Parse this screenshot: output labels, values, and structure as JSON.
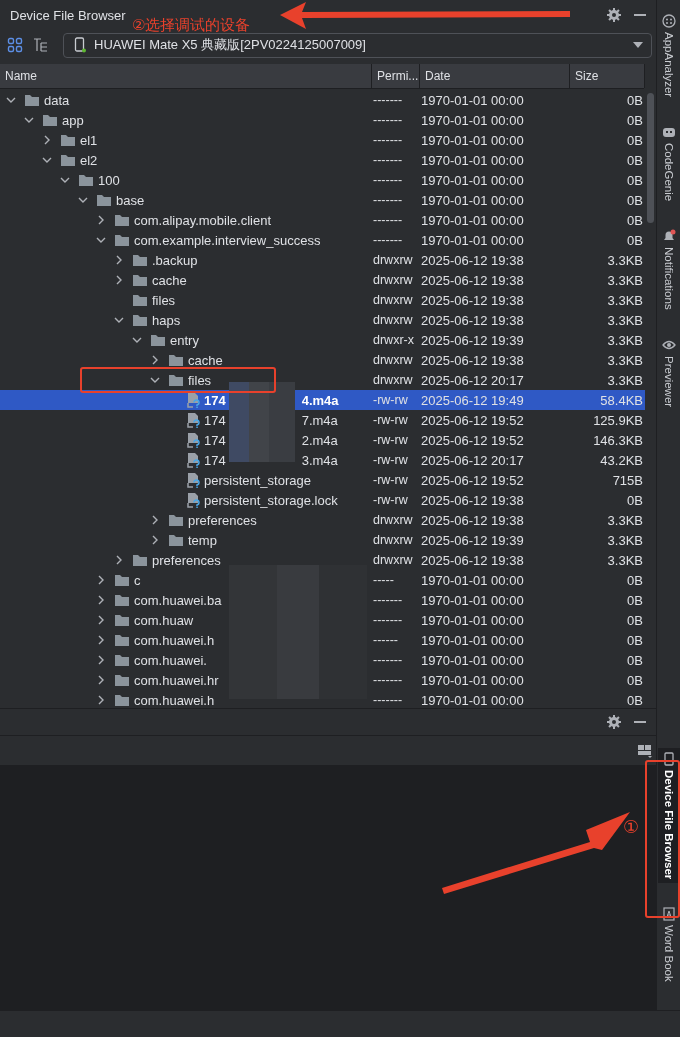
{
  "panel": {
    "title": "Device File Browser"
  },
  "device_selector": {
    "value": "HUAWEI Mate X5 典藏版[2PV0224125007009]"
  },
  "table": {
    "columns": [
      "Name",
      "Permi...",
      "Date",
      "Size"
    ],
    "tree": [
      {
        "name": "data",
        "kind": "folder",
        "expanded": true,
        "selected": false,
        "perm": "-------",
        "date": "1970-01-01 00:00",
        "size": "0B",
        "children": [
          {
            "name": "app",
            "kind": "folder",
            "expanded": true,
            "selected": false,
            "perm": "-------",
            "date": "1970-01-01 00:00",
            "size": "0B",
            "children": [
              {
                "name": "el1",
                "kind": "folder",
                "expanded": false,
                "selected": false,
                "perm": "-------",
                "date": "1970-01-01 00:00",
                "size": "0B"
              },
              {
                "name": "el2",
                "kind": "folder",
                "expanded": true,
                "selected": false,
                "perm": "-------",
                "date": "1970-01-01 00:00",
                "size": "0B",
                "children": [
                  {
                    "name": "100",
                    "kind": "folder",
                    "expanded": true,
                    "selected": false,
                    "perm": "-------",
                    "date": "1970-01-01 00:00",
                    "size": "0B",
                    "children": [
                      {
                        "name": "base",
                        "kind": "folder",
                        "expanded": true,
                        "selected": false,
                        "perm": "-------",
                        "date": "1970-01-01 00:00",
                        "size": "0B",
                        "children": [
                          {
                            "name": "com.alipay.mobile.client",
                            "kind": "folder",
                            "expanded": false,
                            "selected": false,
                            "perm": "-------",
                            "date": "1970-01-01 00:00",
                            "size": "0B"
                          },
                          {
                            "name": "com.example.interview_success",
                            "kind": "folder",
                            "expanded": true,
                            "selected": false,
                            "perm": "-------",
                            "date": "1970-01-01 00:00",
                            "size": "0B",
                            "children": [
                              {
                                "name": ".backup",
                                "kind": "folder",
                                "expanded": false,
                                "selected": false,
                                "perm": "drwxrw",
                                "date": "2025-06-12 19:38",
                                "size": "3.3KB"
                              },
                              {
                                "name": "cache",
                                "kind": "folder",
                                "expanded": false,
                                "selected": false,
                                "perm": "drwxrw",
                                "date": "2025-06-12 19:38",
                                "size": "3.3KB"
                              },
                              {
                                "name": "files",
                                "kind": "folder",
                                "selected": false,
                                "perm": "drwxrw",
                                "date": "2025-06-12 19:38",
                                "size": "3.3KB"
                              },
                              {
                                "name": "haps",
                                "kind": "folder",
                                "expanded": true,
                                "selected": false,
                                "perm": "drwxrw",
                                "date": "2025-06-12 19:38",
                                "size": "3.3KB",
                                "children": [
                                  {
                                    "name": "entry",
                                    "kind": "folder",
                                    "expanded": true,
                                    "selected": false,
                                    "perm": "drwxr-x",
                                    "date": "2025-06-12 19:39",
                                    "size": "3.3KB",
                                    "children": [
                                      {
                                        "name": "cache",
                                        "kind": "folder",
                                        "expanded": false,
                                        "selected": false,
                                        "perm": "drwxrw",
                                        "date": "2025-06-12 19:38",
                                        "size": "3.3KB"
                                      },
                                      {
                                        "name": "files",
                                        "kind": "folder",
                                        "expanded": true,
                                        "selected": false,
                                        "perm": "drwxrw",
                                        "date": "2025-06-12 20:17",
                                        "size": "3.3KB",
                                        "children": [
                                          {
                                            "name": "174",
                                            "name_tail": "4.m4a",
                                            "kind": "file",
                                            "selected": true,
                                            "perm": "-rw-rw",
                                            "date": "2025-06-12 19:49",
                                            "size": "58.4KB"
                                          },
                                          {
                                            "name": "174",
                                            "name_tail": "7.m4a",
                                            "kind": "file",
                                            "selected": false,
                                            "perm": "-rw-rw",
                                            "date": "2025-06-12 19:52",
                                            "size": "125.9KB"
                                          },
                                          {
                                            "name": "174",
                                            "name_tail": "2.m4a",
                                            "kind": "file",
                                            "selected": false,
                                            "perm": "-rw-rw",
                                            "date": "2025-06-12 19:52",
                                            "size": "146.3KB"
                                          },
                                          {
                                            "name": "174",
                                            "name_tail": "3.m4a",
                                            "kind": "file",
                                            "selected": false,
                                            "perm": "-rw-rw",
                                            "date": "2025-06-12 20:17",
                                            "size": "43.2KB"
                                          },
                                          {
                                            "name": "persistent_storage",
                                            "kind": "file",
                                            "selected": false,
                                            "perm": "-rw-rw",
                                            "date": "2025-06-12 19:52",
                                            "size": "715B"
                                          },
                                          {
                                            "name": "persistent_storage.lock",
                                            "kind": "file",
                                            "selected": false,
                                            "perm": "-rw-rw",
                                            "date": "2025-06-12 19:38",
                                            "size": "0B"
                                          }
                                        ]
                                      },
                                      {
                                        "name": "preferences",
                                        "kind": "folder",
                                        "expanded": false,
                                        "selected": false,
                                        "perm": "drwxrw",
                                        "date": "2025-06-12 19:38",
                                        "size": "3.3KB"
                                      },
                                      {
                                        "name": "temp",
                                        "kind": "folder",
                                        "expanded": false,
                                        "selected": false,
                                        "perm": "drwxrw",
                                        "date": "2025-06-12 19:39",
                                        "size": "3.3KB"
                                      }
                                    ]
                                  }
                                ]
                              },
                              {
                                "name": "preferences",
                                "kind": "folder",
                                "expanded": false,
                                "selected": false,
                                "perm": "drwxrw",
                                "date": "2025-06-12 19:38",
                                "size": "3.3KB"
                              }
                            ]
                          },
                          {
                            "name": "c",
                            "kind": "folder",
                            "expanded": false,
                            "selected": false,
                            "perm": "-----",
                            "date": "1970-01-01 00:00",
                            "size": "0B"
                          },
                          {
                            "name": "com.huawei.ba",
                            "kind": "folder",
                            "expanded": false,
                            "selected": false,
                            "perm": "-------",
                            "date": "1970-01-01 00:00",
                            "size": "0B"
                          },
                          {
                            "name": "com.huaw",
                            "kind": "folder",
                            "expanded": false,
                            "selected": false,
                            "perm": "-------",
                            "date": "1970-01-01 00:00",
                            "size": "0B"
                          },
                          {
                            "name": "com.huawei.h",
                            "kind": "folder",
                            "expanded": false,
                            "selected": false,
                            "perm": "------",
                            "date": "1970-01-01 00:00",
                            "size": "0B"
                          },
                          {
                            "name": "com.huawei.",
                            "kind": "folder",
                            "expanded": false,
                            "selected": false,
                            "perm": "-------",
                            "date": "1970-01-01 00:00",
                            "size": "0B"
                          },
                          {
                            "name": "com.huawei.hr",
                            "kind": "folder",
                            "expanded": false,
                            "selected": false,
                            "perm": "-------",
                            "date": "1970-01-01 00:00",
                            "size": "0B"
                          },
                          {
                            "name": "com.huawei.h",
                            "kind": "folder",
                            "expanded": false,
                            "selected": false,
                            "perm": "-------",
                            "date": "1970-01-01 00:00",
                            "size": "0B"
                          }
                        ]
                      }
                    ]
                  }
                ]
              }
            ]
          }
        ]
      }
    ]
  },
  "right_sidebar": {
    "top_tabs": [
      {
        "label": "AppAnalyzer",
        "kind": "analyzer",
        "selected": false
      },
      {
        "label": "CodeGenie",
        "kind": "genie",
        "selected": false
      },
      {
        "label": "Notifications",
        "kind": "bell",
        "selected": false
      },
      {
        "label": "Previewer",
        "kind": "eye",
        "selected": false
      }
    ],
    "bottom_tabs": [
      {
        "label": "Device File Browser",
        "kind": "device",
        "selected": true
      },
      {
        "label": "Word Book",
        "kind": "book",
        "selected": false
      }
    ]
  },
  "annotations": [
    {
      "kind": "label",
      "text": "②选择调试的设备"
    },
    {
      "kind": "label",
      "text": "①"
    }
  ]
}
